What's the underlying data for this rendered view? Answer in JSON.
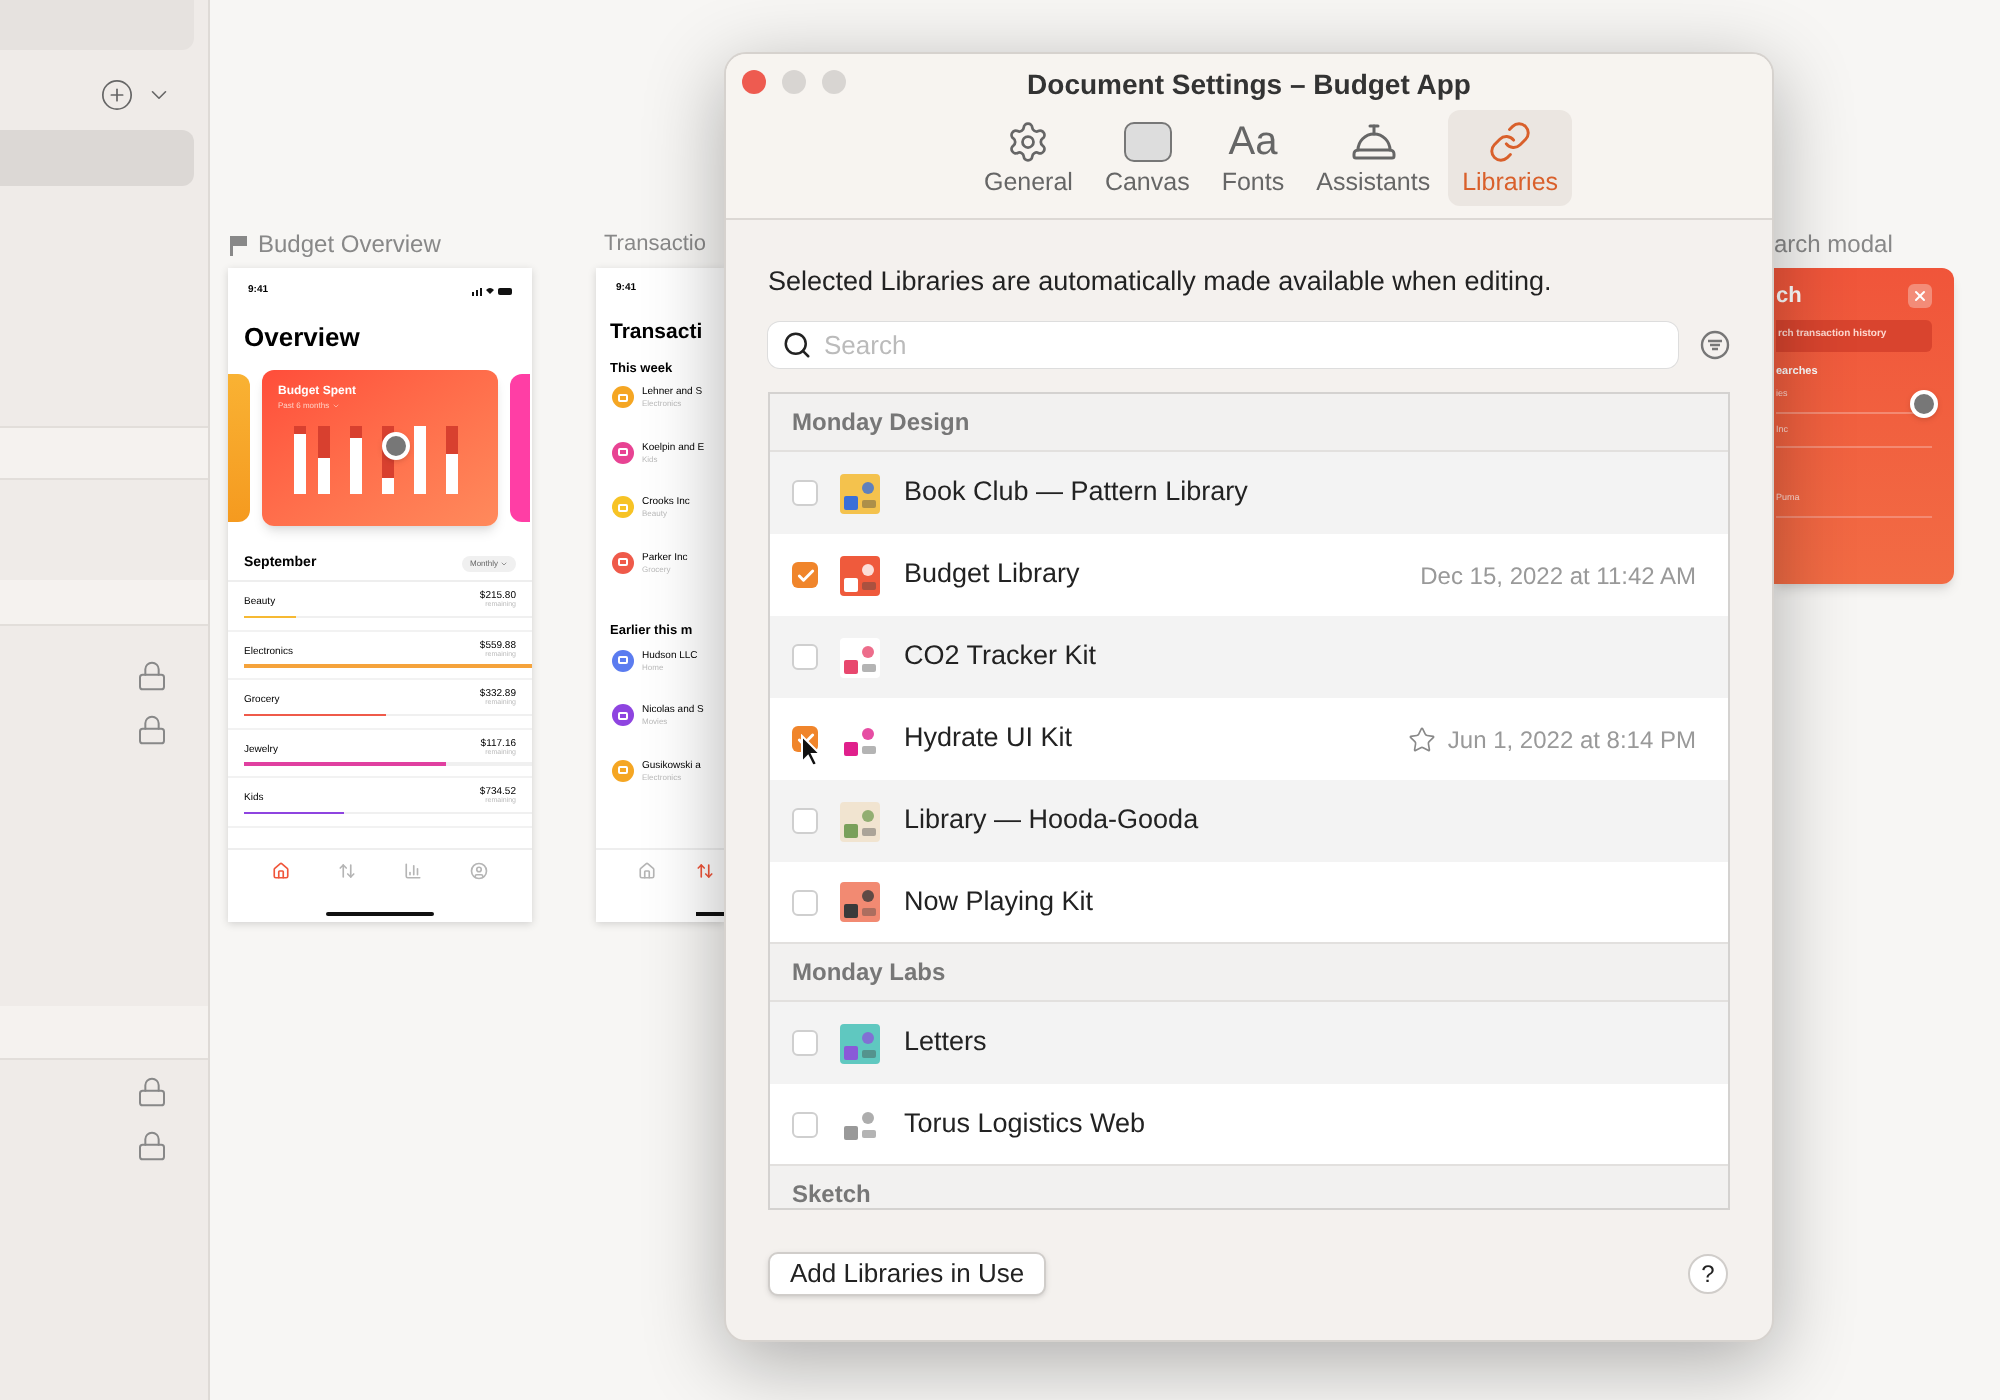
{
  "canvas": {
    "artboards": [
      {
        "kind": "overview",
        "label": "Budget Overview",
        "time": "9:41",
        "title": "Overview",
        "card_title": "Budget Spent",
        "card_subtitle": "Past 6 months",
        "section": "September",
        "period": "Monthly",
        "categories": [
          {
            "name": "Beauty",
            "amount": "$215.80",
            "note": "remaining",
            "level": 0.18,
            "color": "#f6b933"
          },
          {
            "name": "Electronics",
            "amount": "$559.88",
            "note": "remaining",
            "level": 1,
            "color": "#f5a33b"
          },
          {
            "name": "Grocery",
            "amount": "$332.89",
            "note": "remaining",
            "level": 0.49,
            "color": "#ef5a4a"
          },
          {
            "name": "Jewelry",
            "amount": "$117.16",
            "note": "remaining",
            "level": 0.7,
            "color": "#e040a0"
          },
          {
            "name": "Kids",
            "amount": "$734.52",
            "note": "remaining",
            "level": 0.35,
            "color": "#8e44e0"
          }
        ],
        "tab_bar": [
          {
            "kind": "home",
            "selected": true
          },
          {
            "kind": "transfer",
            "selected": false
          },
          {
            "kind": "chart",
            "selected": false
          },
          {
            "kind": "profile",
            "selected": false
          }
        ]
      },
      {
        "kind": "transactions",
        "label": "Transactio",
        "time": "9:41",
        "title": "Transacti",
        "groups": [
          {
            "title": "This week",
            "items": [
              {
                "name": "Lehner and S",
                "category": "Electronics",
                "color": "#f5a623"
              },
              {
                "name": "Koelpin and E",
                "category": "Kids",
                "color": "#e84393"
              },
              {
                "name": "Crooks Inc",
                "category": "Beauty",
                "color": "#f7c325"
              },
              {
                "name": "Parker Inc",
                "category": "Grocery",
                "color": "#ef5a4a"
              }
            ]
          },
          {
            "title": "Earlier this m",
            "items": [
              {
                "name": "Hudson LLC",
                "category": "Home",
                "color": "#5b7cf0"
              },
              {
                "name": "Nicolas and S",
                "category": "Movies",
                "color": "#8e44e0"
              },
              {
                "name": "Gusikowski a",
                "category": "Electronics",
                "color": "#f5a623"
              }
            ]
          }
        ],
        "tab_bar": [
          {
            "kind": "home",
            "selected": false
          },
          {
            "kind": "transfer",
            "selected": true
          }
        ]
      },
      {
        "kind": "modal",
        "label": "arch modal",
        "title": "ch",
        "search_text": "rch transaction history",
        "section": "earches",
        "items": [
          "ies",
          "Inc",
          "Puma"
        ]
      }
    ]
  },
  "dialog": {
    "title": "Document Settings – Budget App",
    "tabs": [
      {
        "label": "General",
        "selected": false
      },
      {
        "label": "Canvas",
        "selected": false
      },
      {
        "label": "Fonts",
        "icon_text": "Aa",
        "selected": false
      },
      {
        "label": "Assistants",
        "selected": false
      },
      {
        "label": "Libraries",
        "selected": true
      }
    ],
    "description": "Selected Libraries are automatically made available when editing.",
    "search": {
      "placeholder": "Search"
    },
    "groups": [
      {
        "title": "Monday Design",
        "libraries": [
          {
            "name": "Book Club — Pattern Library",
            "checked": false,
            "star": false
          },
          {
            "name": "Budget Library",
            "checked": true,
            "star": false,
            "date": "Dec 15, 2022 at 11:42 AM"
          },
          {
            "name": "CO2 Tracker Kit",
            "checked": false,
            "star": false
          },
          {
            "name": "Hydrate UI Kit",
            "checked": true,
            "star": true,
            "date": "Jun 1, 2022 at 8:14 PM"
          },
          {
            "name": "Library — Hooda-Gooda",
            "checked": false,
            "star": false
          },
          {
            "name": "Now Playing Kit",
            "checked": false,
            "star": false
          }
        ]
      },
      {
        "title": "Monday Labs",
        "libraries": [
          {
            "name": "Letters",
            "checked": false,
            "star": false
          },
          {
            "name": "Torus Logistics Web",
            "checked": false,
            "star": false
          }
        ]
      },
      {
        "title": "Sketch"
      }
    ],
    "add_button": "Add Libraries in Use",
    "help_button": "?"
  }
}
